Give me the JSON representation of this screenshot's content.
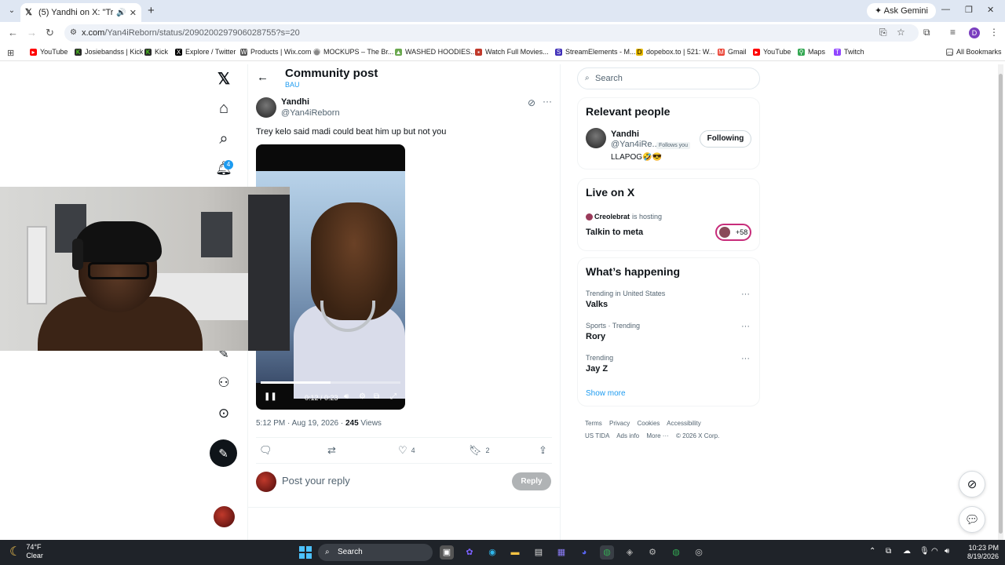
{
  "browser": {
    "tab_title": "(5) Yandhi on X: \"Trey kelo s",
    "ask_gemini": "Ask Gemini",
    "url_host": "x.com",
    "url_path": "/Yan4iReborn/status/2090200297906028755?s=20",
    "profile_initial": "D",
    "bookmarks": [
      "YouTube",
      "Josiebandss | Kick",
      "Kick",
      "Explore / Twitter",
      "Products | Wix.com",
      "MOCKUPS – The Br...",
      "WASHED HOODIES...",
      "Watch Full Movies...",
      "StreamElements - M...",
      "dopebox.to | 521: W...",
      "Gmail",
      "YouTube",
      "Maps",
      "Twitch"
    ],
    "all_bookmarks": "All Bookmarks"
  },
  "nav": {
    "notifications_badge": "4"
  },
  "post": {
    "header_title": "Community post",
    "community": "BAU",
    "author_name": "Yandhi",
    "author_handle": "@Yan4iReborn",
    "text": "Trey kelo said madi could beat him up but not you",
    "video_time": "0:12 / 0:23",
    "video_progress": 0.5,
    "meta_time": "5:12 PM · Aug 19, 2026 · ",
    "views_count": "245",
    "views_label": " Views",
    "likes": "4",
    "bookmarks": "2",
    "reply_placeholder": "Post your reply",
    "reply_button": "Reply"
  },
  "sidebar": {
    "search_placeholder": "Search",
    "relevant_title": "Relevant people",
    "person_name": "Yandhi",
    "person_handle": "@Yan4iRe...",
    "follows_you": "Follows you",
    "person_bio": "LLAPOG🤣😎",
    "following_button": "Following",
    "live_title": "Live on X",
    "live_host": "Creolebrat",
    "live_hosting": "is hosting",
    "live_space": "Talkin to meta",
    "live_count": "+58",
    "happening_title": "What’s happening",
    "trends": [
      {
        "context": "Trending in United States",
        "name": "Valks"
      },
      {
        "context": "Sports · Trending",
        "name": "Rory"
      },
      {
        "context": "Trending",
        "name": "Jay Z"
      }
    ],
    "show_more": "Show more",
    "footer": [
      "Terms",
      "Privacy",
      "Cookies",
      "Accessibility",
      "US TIDA",
      "Ads info",
      "More ···",
      "© 2026 X Corp."
    ]
  },
  "taskbar": {
    "temp": "74°F",
    "condition": "Clear",
    "search": "Search",
    "time": "10:23 PM",
    "date": "8/19/2026"
  },
  "colors": {
    "accent": "#1d9bf0",
    "text": "#0f1419",
    "muted": "#536471"
  }
}
